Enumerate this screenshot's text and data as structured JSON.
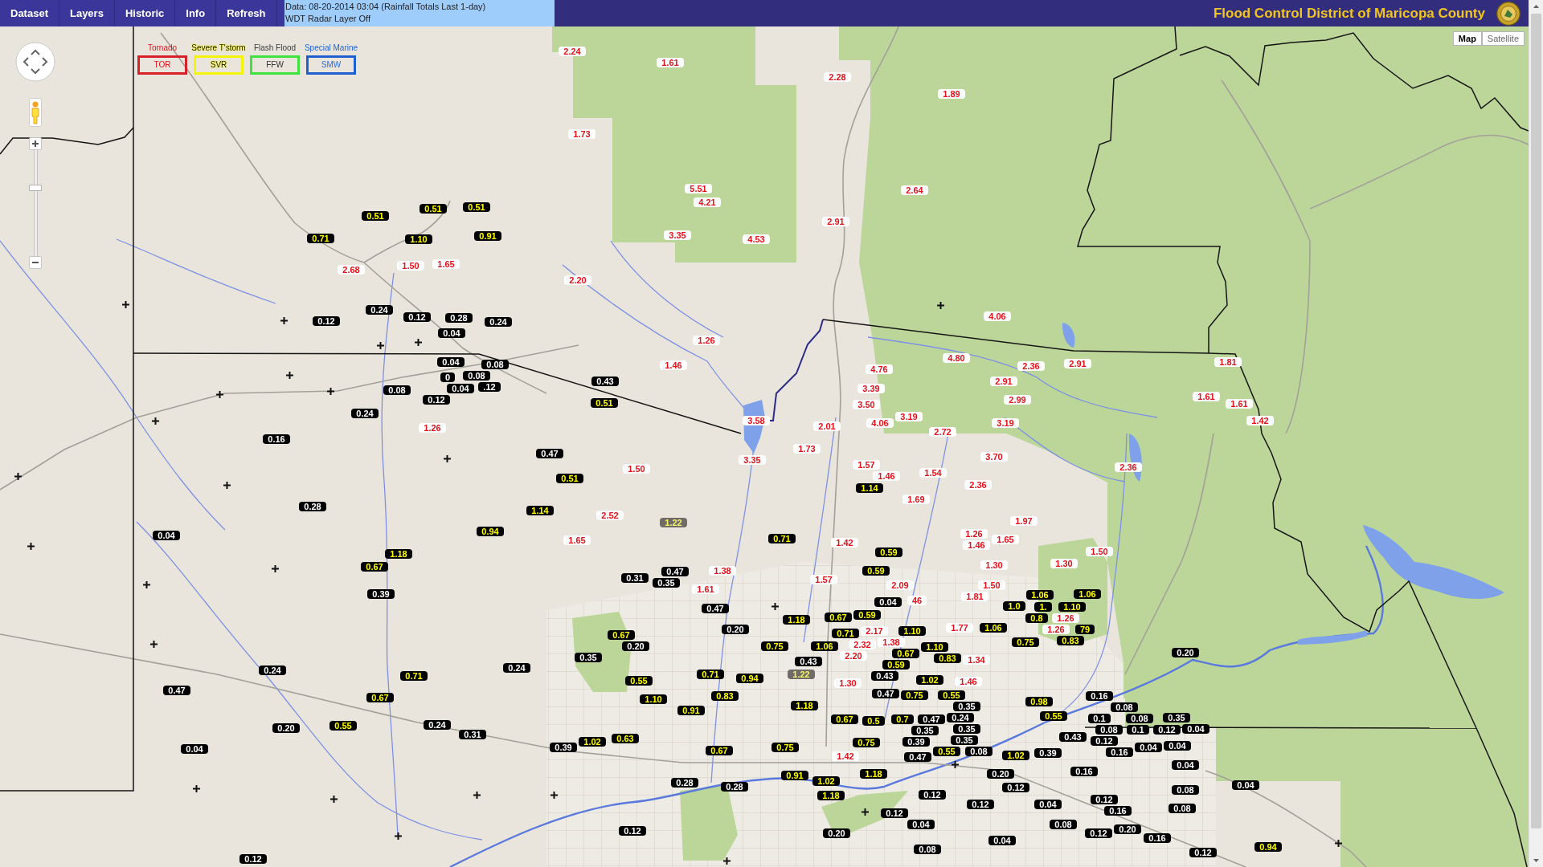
{
  "menu": [
    "Dataset",
    "Layers",
    "Historic",
    "Info",
    "Refresh"
  ],
  "status_lines": [
    "Data: 08-20-2014 03:04 (Rainfall Totals Last 1-day)",
    "WDT Radar Layer Off"
  ],
  "title": "Flood Control District of Maricopa County",
  "map_type_buttons": [
    {
      "label": "Map",
      "selected": true
    },
    {
      "label": "Satellite",
      "selected": false
    }
  ],
  "warnings": [
    {
      "label": "Tornado",
      "code": "TOR",
      "color": "#d8202a"
    },
    {
      "label": "Severe T'storm",
      "code": "SVR",
      "color": "#f4f40a"
    },
    {
      "label": "Flash Flood",
      "code": "FFW",
      "color": "#3fe33f"
    },
    {
      "label": "Special Marine",
      "code": "SMW",
      "color": "#1f5fcf"
    }
  ],
  "map_controls": {
    "zoom": {
      "level": 0.65
    }
  },
  "rainfall_markers": [
    {
      "value": "2.24",
      "kind": "high"
    },
    {
      "value": "1.61",
      "kind": "high"
    },
    {
      "value": "2.28",
      "kind": "high"
    },
    {
      "value": "1.89",
      "kind": "high"
    },
    {
      "value": "1.73",
      "kind": "high"
    },
    {
      "value": "5.51",
      "kind": "high"
    },
    {
      "value": "2.64",
      "kind": "high"
    },
    {
      "value": "4.21",
      "kind": "high"
    },
    {
      "value": "0.51",
      "kind": "mid"
    },
    {
      "value": "0.51",
      "kind": "mid"
    },
    {
      "value": "0.51",
      "kind": "mid"
    },
    {
      "value": "2.91",
      "kind": "high"
    },
    {
      "value": "0.71",
      "kind": "mid"
    },
    {
      "value": "1.10",
      "kind": "mid"
    },
    {
      "value": "0.91",
      "kind": "mid"
    },
    {
      "value": "3.35",
      "kind": "high"
    },
    {
      "value": "4.53",
      "kind": "high"
    },
    {
      "value": "2.68",
      "kind": "high"
    },
    {
      "value": "1.50",
      "kind": "high"
    },
    {
      "value": "1.65",
      "kind": "high"
    },
    {
      "value": "2.20",
      "kind": "high"
    },
    {
      "value": "0.24",
      "kind": "low"
    },
    {
      "value": "0.12",
      "kind": "low"
    },
    {
      "value": "0.12",
      "kind": "low"
    },
    {
      "value": "0.28",
      "kind": "low"
    },
    {
      "value": "0.24",
      "kind": "low"
    },
    {
      "value": "4.06",
      "kind": "high"
    },
    {
      "value": "0.04",
      "kind": "low"
    },
    {
      "value": "1.26",
      "kind": "high"
    },
    {
      "value": "0.04",
      "kind": "low"
    },
    {
      "value": "0.08",
      "kind": "low"
    },
    {
      "value": "1.46",
      "kind": "high"
    },
    {
      "value": "4.76",
      "kind": "high"
    },
    {
      "value": "4.80",
      "kind": "high"
    },
    {
      "value": "2.36",
      "kind": "high"
    },
    {
      "value": "2.91",
      "kind": "high"
    },
    {
      "value": "1.81",
      "kind": "high"
    },
    {
      "value": "0",
      "kind": "low"
    },
    {
      "value": "0.08",
      "kind": "low"
    },
    {
      "value": "0.43",
      "kind": "low"
    },
    {
      "value": "2.91",
      "kind": "high"
    },
    {
      "value": "0.08",
      "kind": "low"
    },
    {
      "value": "0.04",
      "kind": "low"
    },
    {
      "value": ".12",
      "kind": "low"
    },
    {
      "value": "3.39",
      "kind": "high"
    },
    {
      "value": "0.12",
      "kind": "low"
    },
    {
      "value": "0.51",
      "kind": "mid"
    },
    {
      "value": "3.50",
      "kind": "high"
    },
    {
      "value": "2.99",
      "kind": "high"
    },
    {
      "value": "1.61",
      "kind": "high"
    },
    {
      "value": "1.61",
      "kind": "high"
    },
    {
      "value": "0.24",
      "kind": "low"
    },
    {
      "value": "1.26",
      "kind": "high"
    },
    {
      "value": "3.58",
      "kind": "high"
    },
    {
      "value": "2.01",
      "kind": "high"
    },
    {
      "value": "4.06",
      "kind": "high"
    },
    {
      "value": "3.19",
      "kind": "high"
    },
    {
      "value": "2.72",
      "kind": "high"
    },
    {
      "value": "3.19",
      "kind": "high"
    },
    {
      "value": "1.42",
      "kind": "high"
    },
    {
      "value": "0.16",
      "kind": "low"
    },
    {
      "value": "0.47",
      "kind": "low"
    },
    {
      "value": "1.73",
      "kind": "high"
    },
    {
      "value": "3.35",
      "kind": "high"
    },
    {
      "value": "3.70",
      "kind": "high"
    },
    {
      "value": "1.50",
      "kind": "high"
    },
    {
      "value": "1.57",
      "kind": "high"
    },
    {
      "value": "2.36",
      "kind": "high"
    },
    {
      "value": "0.51",
      "kind": "mid"
    },
    {
      "value": "1.46",
      "kind": "high"
    },
    {
      "value": "1.54",
      "kind": "high"
    },
    {
      "value": "1.14",
      "kind": "mid"
    },
    {
      "value": "2.36",
      "kind": "high"
    },
    {
      "value": "1.69",
      "kind": "high"
    },
    {
      "value": "0.28",
      "kind": "low"
    },
    {
      "value": "1.14",
      "kind": "mid"
    },
    {
      "value": "2.52",
      "kind": "high"
    },
    {
      "value": "1.22",
      "kind": "stale"
    },
    {
      "value": "1.97",
      "kind": "high"
    },
    {
      "value": "0.04",
      "kind": "low"
    },
    {
      "value": "0.94",
      "kind": "mid"
    },
    {
      "value": "1.26",
      "kind": "high"
    },
    {
      "value": "1.65",
      "kind": "high"
    },
    {
      "value": "0.71",
      "kind": "mid"
    },
    {
      "value": "1.42",
      "kind": "high"
    },
    {
      "value": "1.46",
      "kind": "high"
    },
    {
      "value": "1.65",
      "kind": "high"
    },
    {
      "value": "1.18",
      "kind": "mid"
    },
    {
      "value": "0.59",
      "kind": "mid"
    },
    {
      "value": "1.50",
      "kind": "high"
    },
    {
      "value": "0.67",
      "kind": "mid"
    },
    {
      "value": "1.30",
      "kind": "high"
    },
    {
      "value": "1.30",
      "kind": "high"
    },
    {
      "value": "0.47",
      "kind": "low"
    },
    {
      "value": "1.38",
      "kind": "high"
    },
    {
      "value": "0.59",
      "kind": "mid"
    },
    {
      "value": "0.31",
      "kind": "low"
    },
    {
      "value": "0.35",
      "kind": "low"
    },
    {
      "value": "1.57",
      "kind": "high"
    },
    {
      "value": "1.61",
      "kind": "high"
    },
    {
      "value": "2.09",
      "kind": "high"
    },
    {
      "value": "1.50",
      "kind": "high"
    },
    {
      "value": "0.39",
      "kind": "low"
    },
    {
      "value": "46",
      "kind": "high"
    },
    {
      "value": "1.81",
      "kind": "high"
    },
    {
      "value": "1.06",
      "kind": "mid"
    },
    {
      "value": "1.06",
      "kind": "mid"
    },
    {
      "value": "0.47",
      "kind": "low"
    },
    {
      "value": "0.04",
      "kind": "low"
    },
    {
      "value": "1.0",
      "kind": "mid"
    },
    {
      "value": "1.",
      "kind": "mid"
    },
    {
      "value": "1.10",
      "kind": "mid"
    },
    {
      "value": "1.18",
      "kind": "mid"
    },
    {
      "value": "0.67",
      "kind": "mid"
    },
    {
      "value": "0.59",
      "kind": "mid"
    },
    {
      "value": "0.8",
      "kind": "mid"
    },
    {
      "value": "1.26",
      "kind": "high"
    },
    {
      "value": "0.20",
      "kind": "low"
    },
    {
      "value": "2.17",
      "kind": "high"
    },
    {
      "value": "1.10",
      "kind": "mid"
    },
    {
      "value": "1.77",
      "kind": "high"
    },
    {
      "value": "1.06",
      "kind": "mid"
    },
    {
      "value": "1.26",
      "kind": "high"
    },
    {
      "value": "79",
      "kind": "mid"
    },
    {
      "value": "0.67",
      "kind": "mid"
    },
    {
      "value": "0.71",
      "kind": "mid"
    },
    {
      "value": "0.83",
      "kind": "mid"
    },
    {
      "value": "0.20",
      "kind": "low"
    },
    {
      "value": "0.75",
      "kind": "mid"
    },
    {
      "value": "1.06",
      "kind": "mid"
    },
    {
      "value": "2.32",
      "kind": "high"
    },
    {
      "value": "1.38",
      "kind": "high"
    },
    {
      "value": "1.10",
      "kind": "mid"
    },
    {
      "value": "0.75",
      "kind": "mid"
    },
    {
      "value": "0.35",
      "kind": "low"
    },
    {
      "value": "2.20",
      "kind": "high"
    },
    {
      "value": "0.67",
      "kind": "mid"
    },
    {
      "value": "0.83",
      "kind": "mid"
    },
    {
      "value": "0.20",
      "kind": "low"
    },
    {
      "value": "0.43",
      "kind": "low"
    },
    {
      "value": "0.59",
      "kind": "mid"
    },
    {
      "value": "1.34",
      "kind": "high"
    },
    {
      "value": "0.24",
      "kind": "low"
    },
    {
      "value": "0.71",
      "kind": "mid"
    },
    {
      "value": "0.24",
      "kind": "low"
    },
    {
      "value": "0.55",
      "kind": "mid"
    },
    {
      "value": "0.71",
      "kind": "mid"
    },
    {
      "value": "0.94",
      "kind": "mid"
    },
    {
      "value": "1.22",
      "kind": "stale"
    },
    {
      "value": "1.30",
      "kind": "high"
    },
    {
      "value": "0.43",
      "kind": "low"
    },
    {
      "value": "1.02",
      "kind": "mid"
    },
    {
      "value": "1.46",
      "kind": "high"
    },
    {
      "value": "0.47",
      "kind": "low"
    },
    {
      "value": "0.67",
      "kind": "mid"
    },
    {
      "value": "1.10",
      "kind": "mid"
    },
    {
      "value": "0.83",
      "kind": "mid"
    },
    {
      "value": "0.47",
      "kind": "low"
    },
    {
      "value": "0.75",
      "kind": "mid"
    },
    {
      "value": "0.55",
      "kind": "mid"
    },
    {
      "value": "0.98",
      "kind": "mid"
    },
    {
      "value": "0.16",
      "kind": "low"
    },
    {
      "value": "0.91",
      "kind": "mid"
    },
    {
      "value": "1.18",
      "kind": "mid"
    },
    {
      "value": "0.35",
      "kind": "low"
    },
    {
      "value": "0.08",
      "kind": "low"
    },
    {
      "value": "0.67",
      "kind": "mid"
    },
    {
      "value": "0.5",
      "kind": "mid"
    },
    {
      "value": "0.7",
      "kind": "mid"
    },
    {
      "value": "0.47",
      "kind": "low"
    },
    {
      "value": "0.24",
      "kind": "low"
    },
    {
      "value": "0.55",
      "kind": "mid"
    },
    {
      "value": "0.08",
      "kind": "low"
    },
    {
      "value": "0.35",
      "kind": "low"
    },
    {
      "value": "0.20",
      "kind": "low"
    },
    {
      "value": "0.55",
      "kind": "mid"
    },
    {
      "value": "0.24",
      "kind": "low"
    },
    {
      "value": "0.35",
      "kind": "low"
    },
    {
      "value": "0.1",
      "kind": "low"
    },
    {
      "value": "0.08",
      "kind": "low"
    },
    {
      "value": "0.1",
      "kind": "low"
    },
    {
      "value": "0.12",
      "kind": "low"
    },
    {
      "value": "0.04",
      "kind": "low"
    },
    {
      "value": "0.31",
      "kind": "low"
    },
    {
      "value": "0.35",
      "kind": "low"
    },
    {
      "value": "0.43",
      "kind": "low"
    },
    {
      "value": "1.02",
      "kind": "mid"
    },
    {
      "value": "0.63",
      "kind": "mid"
    },
    {
      "value": "0.75",
      "kind": "mid"
    },
    {
      "value": "0.39",
      "kind": "low"
    },
    {
      "value": "0.35",
      "kind": "low"
    },
    {
      "value": "0.12",
      "kind": "low"
    },
    {
      "value": "0.04",
      "kind": "low"
    },
    {
      "value": "0.39",
      "kind": "low"
    },
    {
      "value": "0.67",
      "kind": "mid"
    },
    {
      "value": "0.75",
      "kind": "mid"
    },
    {
      "value": "0.55",
      "kind": "mid"
    },
    {
      "value": "0.08",
      "kind": "low"
    },
    {
      "value": "0.16",
      "kind": "low"
    },
    {
      "value": "0.04",
      "kind": "low"
    },
    {
      "value": "0.04",
      "kind": "low"
    },
    {
      "value": "1.42",
      "kind": "high"
    },
    {
      "value": "0.47",
      "kind": "low"
    },
    {
      "value": "1.02",
      "kind": "mid"
    },
    {
      "value": "0.39",
      "kind": "low"
    },
    {
      "value": "0.04",
      "kind": "low"
    },
    {
      "value": "0.91",
      "kind": "mid"
    },
    {
      "value": "1.18",
      "kind": "mid"
    },
    {
      "value": "0.20",
      "kind": "low"
    },
    {
      "value": "0.16",
      "kind": "low"
    },
    {
      "value": "0.28",
      "kind": "low"
    },
    {
      "value": "0.28",
      "kind": "low"
    },
    {
      "value": "1.02",
      "kind": "mid"
    },
    {
      "value": "0.12",
      "kind": "low"
    },
    {
      "value": "0.04",
      "kind": "low"
    },
    {
      "value": "1.18",
      "kind": "mid"
    },
    {
      "value": "0.12",
      "kind": "low"
    },
    {
      "value": "0.08",
      "kind": "low"
    },
    {
      "value": "0.12",
      "kind": "low"
    },
    {
      "value": "0.04",
      "kind": "low"
    },
    {
      "value": "0.12",
      "kind": "low"
    },
    {
      "value": "0.12",
      "kind": "low"
    },
    {
      "value": "0.16",
      "kind": "low"
    },
    {
      "value": "0.08",
      "kind": "low"
    },
    {
      "value": "0.12",
      "kind": "low"
    },
    {
      "value": "0.20",
      "kind": "low"
    },
    {
      "value": "0.04",
      "kind": "low"
    },
    {
      "value": "0.04",
      "kind": "low"
    },
    {
      "value": "0.08",
      "kind": "low"
    },
    {
      "value": "0.12",
      "kind": "low"
    },
    {
      "value": "0.20",
      "kind": "low"
    },
    {
      "value": "0.16",
      "kind": "low"
    },
    {
      "value": "0.12",
      "kind": "low"
    },
    {
      "value": "0.08",
      "kind": "low"
    },
    {
      "value": "0.12",
      "kind": "low"
    },
    {
      "value": "0.94",
      "kind": "mid"
    }
  ]
}
